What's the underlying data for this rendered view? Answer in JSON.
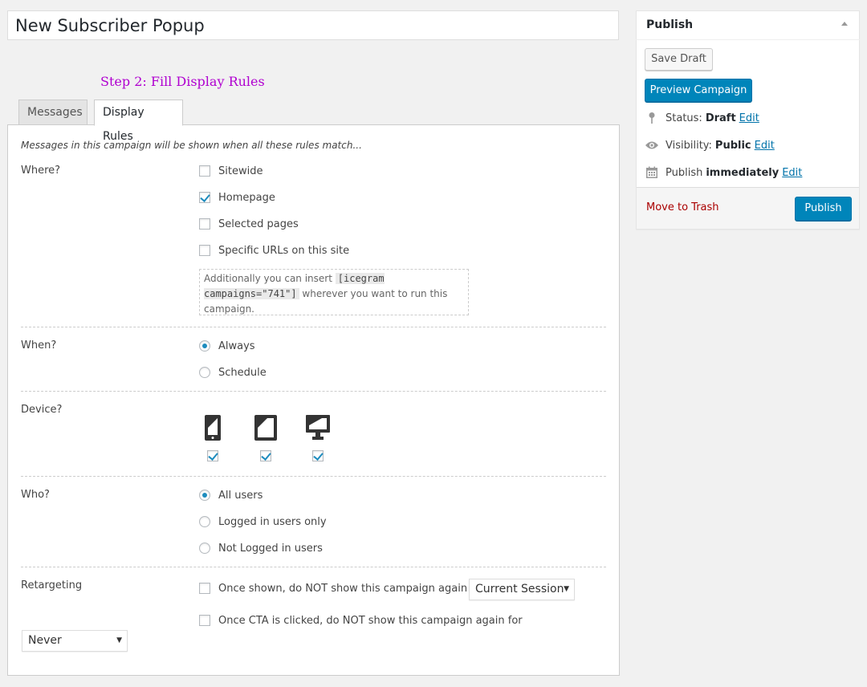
{
  "title": {
    "value": "New Subscriber Popup"
  },
  "step_label": "Step 2: Fill Display Rules",
  "tabs": [
    {
      "label": "Messages",
      "active": false
    },
    {
      "label": "Display Rules",
      "active": true
    }
  ],
  "intro": "Messages in this campaign will be shown when all these rules match...",
  "where": {
    "label": "Where?",
    "options": [
      {
        "label": "Sitewide",
        "checked": false
      },
      {
        "label": "Homepage",
        "checked": true
      },
      {
        "label": "Selected pages",
        "checked": false
      },
      {
        "label": "Specific URLs on this site",
        "checked": false
      }
    ],
    "note_prefix": "Additionally you can insert ",
    "note_code": "[icegram campaigns=\"741\"]",
    "note_suffix": " wherever you want to run this campaign."
  },
  "when": {
    "label": "When?",
    "options": [
      {
        "label": "Always",
        "checked": true
      },
      {
        "label": "Schedule",
        "checked": false
      }
    ]
  },
  "device": {
    "label": "Device?",
    "items": [
      {
        "icon": "mobile-icon",
        "checked": true
      },
      {
        "icon": "tablet-icon",
        "checked": true
      },
      {
        "icon": "desktop-icon",
        "checked": true
      }
    ]
  },
  "who": {
    "label": "Who?",
    "options": [
      {
        "label": "All users",
        "checked": true
      },
      {
        "label": "Logged in users only",
        "checked": false
      },
      {
        "label": "Not Logged in users",
        "checked": false
      }
    ]
  },
  "retargeting": {
    "label": "Retargeting",
    "shown_label": "Once shown, do NOT show this campaign again for",
    "shown_checked": false,
    "shown_select": "Current Session",
    "cta_label": "Once CTA is clicked, do NOT show this campaign again for",
    "cta_checked": false,
    "cta_select": "Never"
  },
  "publish": {
    "title": "Publish",
    "save_draft": "Save Draft",
    "preview": "Preview Campaign",
    "status_label": "Status:",
    "status_value": "Draft",
    "visibility_label": "Visibility:",
    "visibility_value": "Public",
    "schedule_label": "Publish",
    "schedule_value": "immediately",
    "edit": "Edit",
    "trash": "Move to Trash",
    "publish_button": "Publish"
  },
  "colors": {
    "primary": "#0085ba",
    "link": "#0073aa",
    "trash": "#aa0000",
    "step_label": "#b000d0",
    "check": "#1e8cbe"
  }
}
